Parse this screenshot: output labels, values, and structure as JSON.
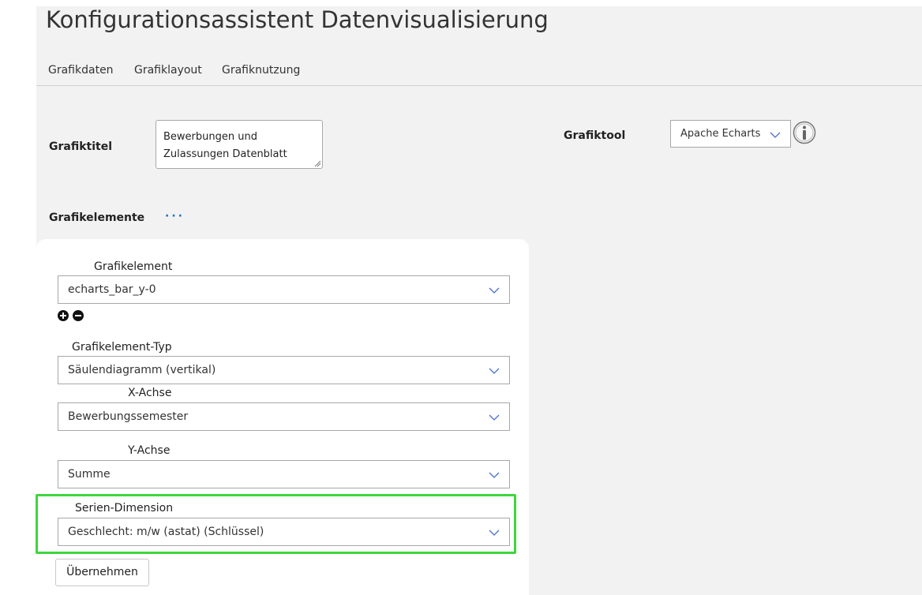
{
  "header": {
    "title": "Konfigurationsassistent Datenvisualisierung"
  },
  "tabs": [
    {
      "label": "Grafikdaten"
    },
    {
      "label": "Grafiklayout"
    },
    {
      "label": "Grafiknutzung"
    }
  ],
  "grafiktitel": {
    "label": "Grafiktitel",
    "value": "Bewerbungen und Zulassungen Datenblatt"
  },
  "grafiktool": {
    "label": "Grafiktool",
    "selected": "Apache Echarts",
    "info_icon": "info-icon"
  },
  "grafikelemente": {
    "label": "Grafikelemente",
    "more": "···"
  },
  "form": {
    "element": {
      "label": "Grafikelement",
      "selected": "echarts_bar_y-0"
    },
    "element_type": {
      "label": "Grafikelement-Typ",
      "selected": "Säulendiagramm (vertikal)"
    },
    "x_axis": {
      "label": "X-Achse",
      "selected": "Bewerbungssemester"
    },
    "y_axis": {
      "label": "Y-Achse",
      "selected": "Summe"
    },
    "series": {
      "label": "Serien-Dimension",
      "selected": "Geschlecht: m/w (astat) (Schlüssel)"
    },
    "apply_label": "Übernehmen"
  },
  "colors": {
    "accent": "#1a73c9",
    "highlight": "#3ed63e",
    "chevron": "#4a6fd1"
  }
}
